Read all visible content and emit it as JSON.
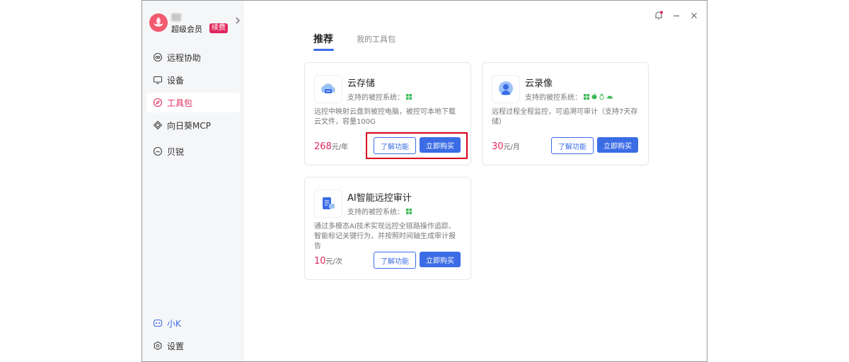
{
  "sidebar": {
    "vip_label": "超级会员",
    "renew_badge": "续费",
    "items": [
      {
        "label": "远程协助",
        "icon": "remote-assist-icon"
      },
      {
        "label": "设备",
        "icon": "monitor-icon"
      },
      {
        "label": "工具包",
        "icon": "compass-icon"
      },
      {
        "label": "向日葵MCP",
        "icon": "mcp-icon"
      },
      {
        "label": "贝锐",
        "icon": "circle-icon"
      }
    ],
    "bottom_items": [
      {
        "label": "小K",
        "icon": "assistant-icon"
      },
      {
        "label": "设置",
        "icon": "gear-icon"
      }
    ]
  },
  "tabs": [
    {
      "label": "推荐"
    },
    {
      "label": "我的工具包"
    }
  ],
  "cards": [
    {
      "name": "云存储",
      "support_label": "支持的被控系统：",
      "description": "远控中映射云盘到被控电脑，被控可本地下载云文件，容量100G",
      "price": "268",
      "unit": "元/年",
      "learn_label": "了解功能",
      "buy_label": "立即购买"
    },
    {
      "name": "云录像",
      "support_label": "支持的被控系统：",
      "description": "远程过程全程监控，可追溯可审计（支持7天存储）",
      "price": "30",
      "unit": "元/月",
      "learn_label": "了解功能",
      "buy_label": "立即购买"
    },
    {
      "name": "AI智能远控审计",
      "support_label": "支持的被控系统：",
      "description": "通过多模态AI技术实现远控全链路操作追踪、智能标记关键行为，并按照时间轴生成审计报告",
      "price": "10",
      "unit": "元/次",
      "learn_label": "了解功能",
      "buy_label": "立即购买"
    }
  ],
  "colors": {
    "accent": "#3b6ce5",
    "brand_pink": "#e0285d",
    "highlight_red": "#d9001b",
    "windows_green": "#3cba54"
  }
}
